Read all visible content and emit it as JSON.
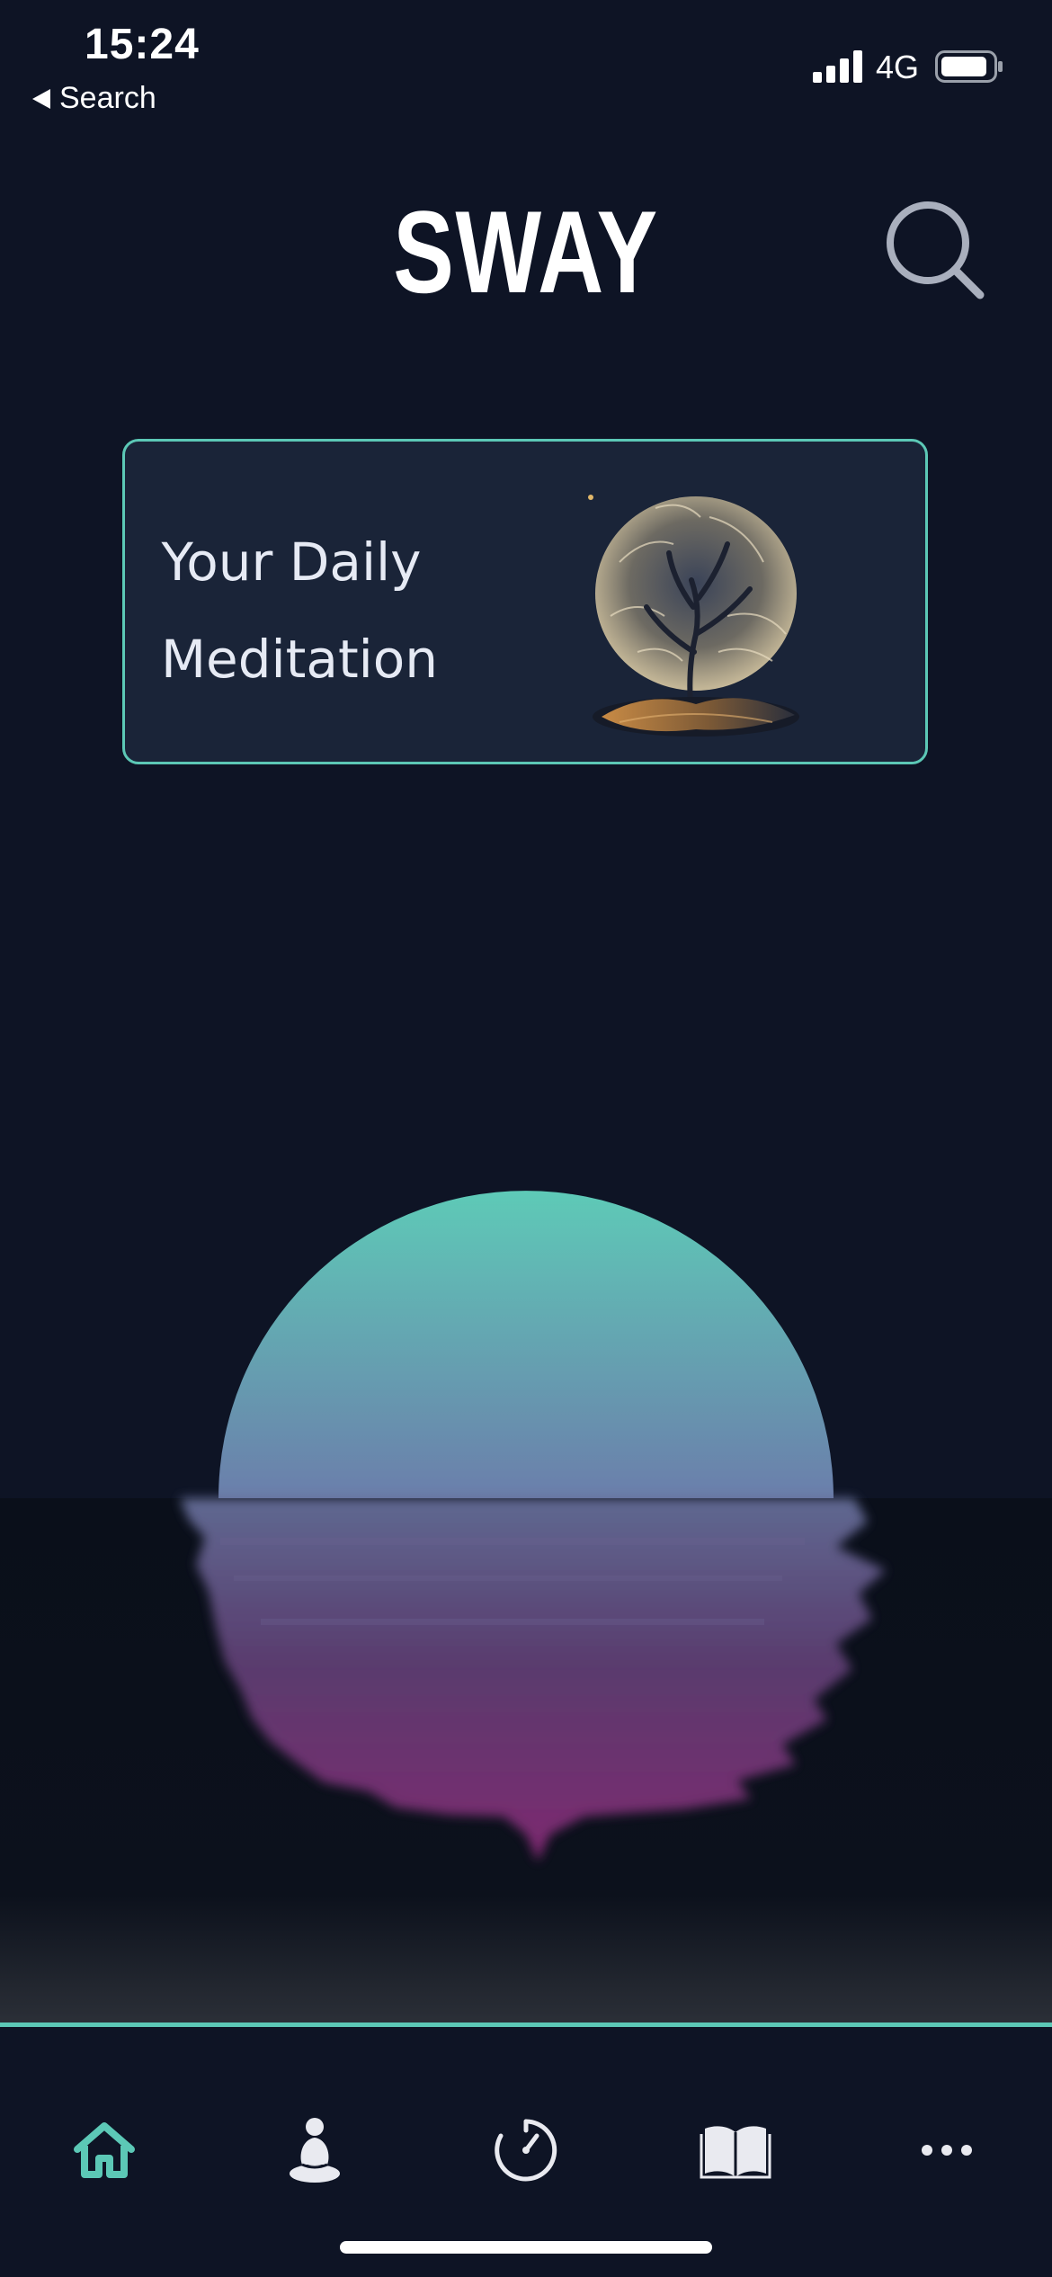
{
  "status_bar": {
    "time": "15:24",
    "back_label": "Search",
    "network": "4G",
    "signal_icon": "cellular-signal-icon",
    "battery_icon": "battery-icon"
  },
  "header": {
    "app_title": "SWAY",
    "search_icon": "search-icon"
  },
  "daily_card": {
    "title": "Your Daily Meditation",
    "image_icon": "tree-illustration"
  },
  "colors": {
    "background": "#0e1425",
    "accent": "#5cc8b6",
    "card_background": "#1a2438",
    "sun_top": "#5ecab7",
    "sun_reflection": "#7c2b72"
  },
  "tab_bar": {
    "tabs": [
      {
        "icon": "home-icon",
        "active": true
      },
      {
        "icon": "meditation-icon",
        "active": false
      },
      {
        "icon": "timer-icon",
        "active": false
      },
      {
        "icon": "book-icon",
        "active": false
      },
      {
        "icon": "more-icon",
        "active": false
      }
    ]
  }
}
